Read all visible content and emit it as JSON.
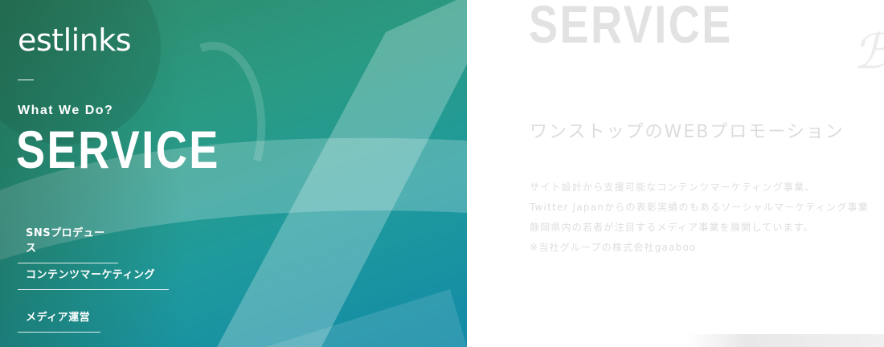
{
  "brand": {
    "logo_text": "estlinks"
  },
  "hero": {
    "eyebrow": "What We Do?",
    "title": "SERVICE"
  },
  "nav": {
    "items": [
      {
        "label": "SNSプロデュース"
      },
      {
        "label": "コンテンツマーケティング"
      },
      {
        "label": "メディア運営"
      }
    ]
  },
  "content": {
    "heading_ghost": "SERVICE",
    "subtitle": "ワンストップのWEBプロモーション",
    "description_lines": [
      "サイト設計から支援可能なコンテンツマーケティング事業、",
      "Twitter Japanからの表彰実績のもあるソーシャルマーケティング事業",
      "静岡県内の若者が注目するメディア事業を展開しています。",
      "※当社グループの株式会社gaaboo"
    ]
  },
  "colors": {
    "panel_green": "#2f8a6a",
    "panel_teal": "#138aa8",
    "ghost_text": "#e2e2e2"
  }
}
